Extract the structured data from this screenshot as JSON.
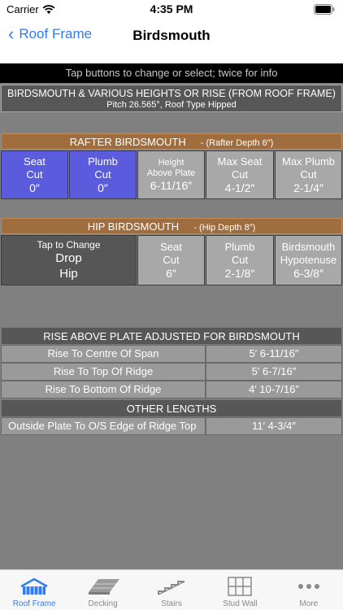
{
  "status": {
    "carrier": "Carrier",
    "time": "4:35 PM"
  },
  "nav": {
    "back_label": "Roof Frame",
    "title": "Birdsmouth"
  },
  "info_banner": "Tap buttons to change or select; twice for info",
  "header": {
    "title": "BIRDSMOUTH & VARIOUS HEIGHTS OR RISE (FROM ROOF FRAME)",
    "subtitle": "Pitch 26.565°, Roof Type Hipped"
  },
  "rafter": {
    "title": "RAFTER BIRDSMOUTH",
    "depth": "- (Rafter Depth 6″)",
    "buttons": [
      {
        "l1": "Seat",
        "l2": "Cut",
        "value": "0″"
      },
      {
        "l1": "Plumb",
        "l2": "Cut",
        "value": "0″"
      },
      {
        "l1": "Height",
        "l2": "Above Plate",
        "value": "6-11/16″"
      },
      {
        "l1": "Max Seat",
        "l2": "Cut",
        "value": "4-1/2″"
      },
      {
        "l1": "Max Plumb",
        "l2": "Cut",
        "value": "2-1/4″"
      }
    ]
  },
  "hip": {
    "title": "HIP BIRDSMOUTH",
    "depth": "- (Hip Depth 8″)",
    "toggle": {
      "l1": "Tap to Change",
      "l2": "Drop",
      "l3": "Hip"
    },
    "buttons": [
      {
        "l1": "Seat",
        "l2": "Cut",
        "value": "6″"
      },
      {
        "l1": "Plumb",
        "l2": "Cut",
        "value": "2-1/8″"
      },
      {
        "l1": "Birdsmouth",
        "l2": "Hypotenuse",
        "value": "6-3/8″"
      }
    ]
  },
  "rise": {
    "title": "RISE ABOVE PLATE ADJUSTED FOR BIRDSMOUTH",
    "rows": [
      {
        "label": "Rise To Centre Of Span",
        "value": "5′ 6-11/16″"
      },
      {
        "label": "Rise To Top Of Ridge",
        "value": "5′ 6-7/16″"
      },
      {
        "label": "Rise To Bottom Of Ridge",
        "value": "4′ 10-7/16″"
      }
    ]
  },
  "other": {
    "title": "OTHER LENGTHS",
    "rows": [
      {
        "label": "Outside Plate To O/S Edge of Ridge Top",
        "value": "11′ 4-3/4″"
      }
    ]
  },
  "tabs": [
    {
      "label": "Roof Frame",
      "icon": "roof-frame-icon",
      "active": true
    },
    {
      "label": "Decking",
      "icon": "decking-icon",
      "active": false
    },
    {
      "label": "Stairs",
      "icon": "stairs-icon",
      "active": false
    },
    {
      "label": "Stud Wall",
      "icon": "stud-wall-icon",
      "active": false
    },
    {
      "label": "More",
      "icon": "more-icon",
      "active": false
    }
  ],
  "colors": {
    "accent": "#2f7bf5",
    "section_brown": "#a06d3e",
    "selected_blue": "#5b5bde",
    "background_gray": "#808080"
  }
}
